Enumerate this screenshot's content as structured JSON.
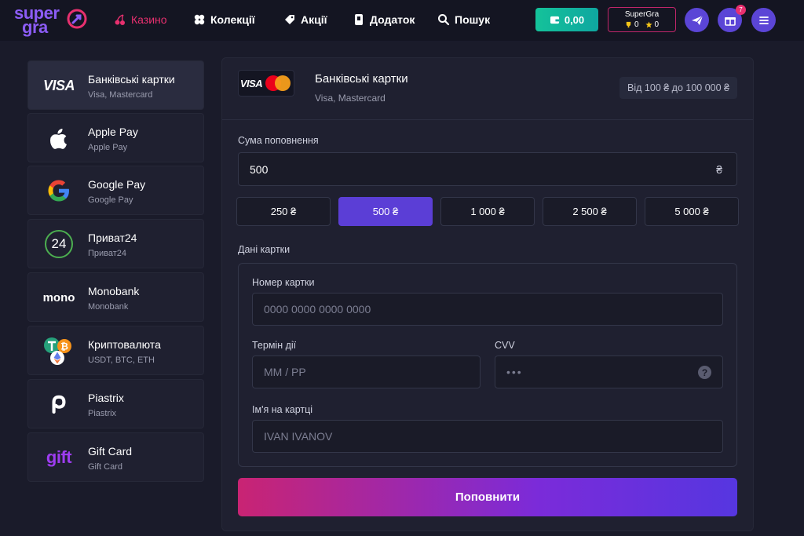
{
  "brand": {
    "logo_top": "super",
    "logo_bottom": "gra"
  },
  "nav": [
    {
      "label": "Казино",
      "icon": "cherries-icon",
      "active": true
    },
    {
      "label": "Колекції",
      "icon": "clover-icon",
      "active": false
    },
    {
      "label": "Акції",
      "icon": "tag-icon",
      "active": false
    },
    {
      "label": "Додаток",
      "icon": "phone-icon",
      "active": false
    },
    {
      "label": "Пошук",
      "icon": "search-icon",
      "active": false
    }
  ],
  "header": {
    "balance": "0,00",
    "username": "SuperGra",
    "trophies": "0",
    "stars": "0",
    "gift_badge": "7"
  },
  "colors": {
    "accent": "#5b3ed6",
    "active_nav": "#e8306f",
    "balance": "#14c29a"
  },
  "sidebar": {
    "items": [
      {
        "title": "Банківські картки",
        "sub": "Visa, Mastercard",
        "icon": "visa-icon",
        "active": true
      },
      {
        "title": "Apple Pay",
        "sub": "Apple Pay",
        "icon": "apple-icon"
      },
      {
        "title": "Google Pay",
        "sub": "Google Pay",
        "icon": "google-icon"
      },
      {
        "title": "Приват24",
        "sub": "Приват24",
        "icon": "privat24-icon",
        "icon_text": "24"
      },
      {
        "title": "Monobank",
        "sub": "Monobank",
        "icon": "monobank-icon",
        "icon_text": "mono"
      },
      {
        "title": "Криптовалюта",
        "sub": "USDT, BTC, ETH",
        "icon": "crypto-icon"
      },
      {
        "title": "Piastrix",
        "sub": "Piastrix",
        "icon": "piastrix-icon"
      },
      {
        "title": "Gift Card",
        "sub": "Gift Card",
        "icon": "gift-icon",
        "icon_text": "gift"
      }
    ]
  },
  "panel": {
    "visa_text": "VISA",
    "title": "Банківські картки",
    "sub": "Visa, Mastercard",
    "limits": "Від 100 ₴ до 100 000 ₴",
    "amount_label": "Сума поповнення",
    "amount_value": "500",
    "currency": "₴",
    "presets": [
      "250 ₴",
      "500 ₴",
      "1 000 ₴",
      "2 500 ₴",
      "5 000 ₴"
    ],
    "selected_preset": 1,
    "card_section_label": "Дані картки",
    "card_number_label": "Номер картки",
    "card_number_placeholder": "0000 0000 0000 0000",
    "expiry_label": "Термін дії",
    "expiry_placeholder": "ММ / РР",
    "cvv_label": "CVV",
    "cvv_placeholder": "•••",
    "cvv_help": "?",
    "name_label": "Ім'я на картці",
    "name_placeholder": "IVAN IVANOV",
    "submit_label": "Поповнити"
  }
}
